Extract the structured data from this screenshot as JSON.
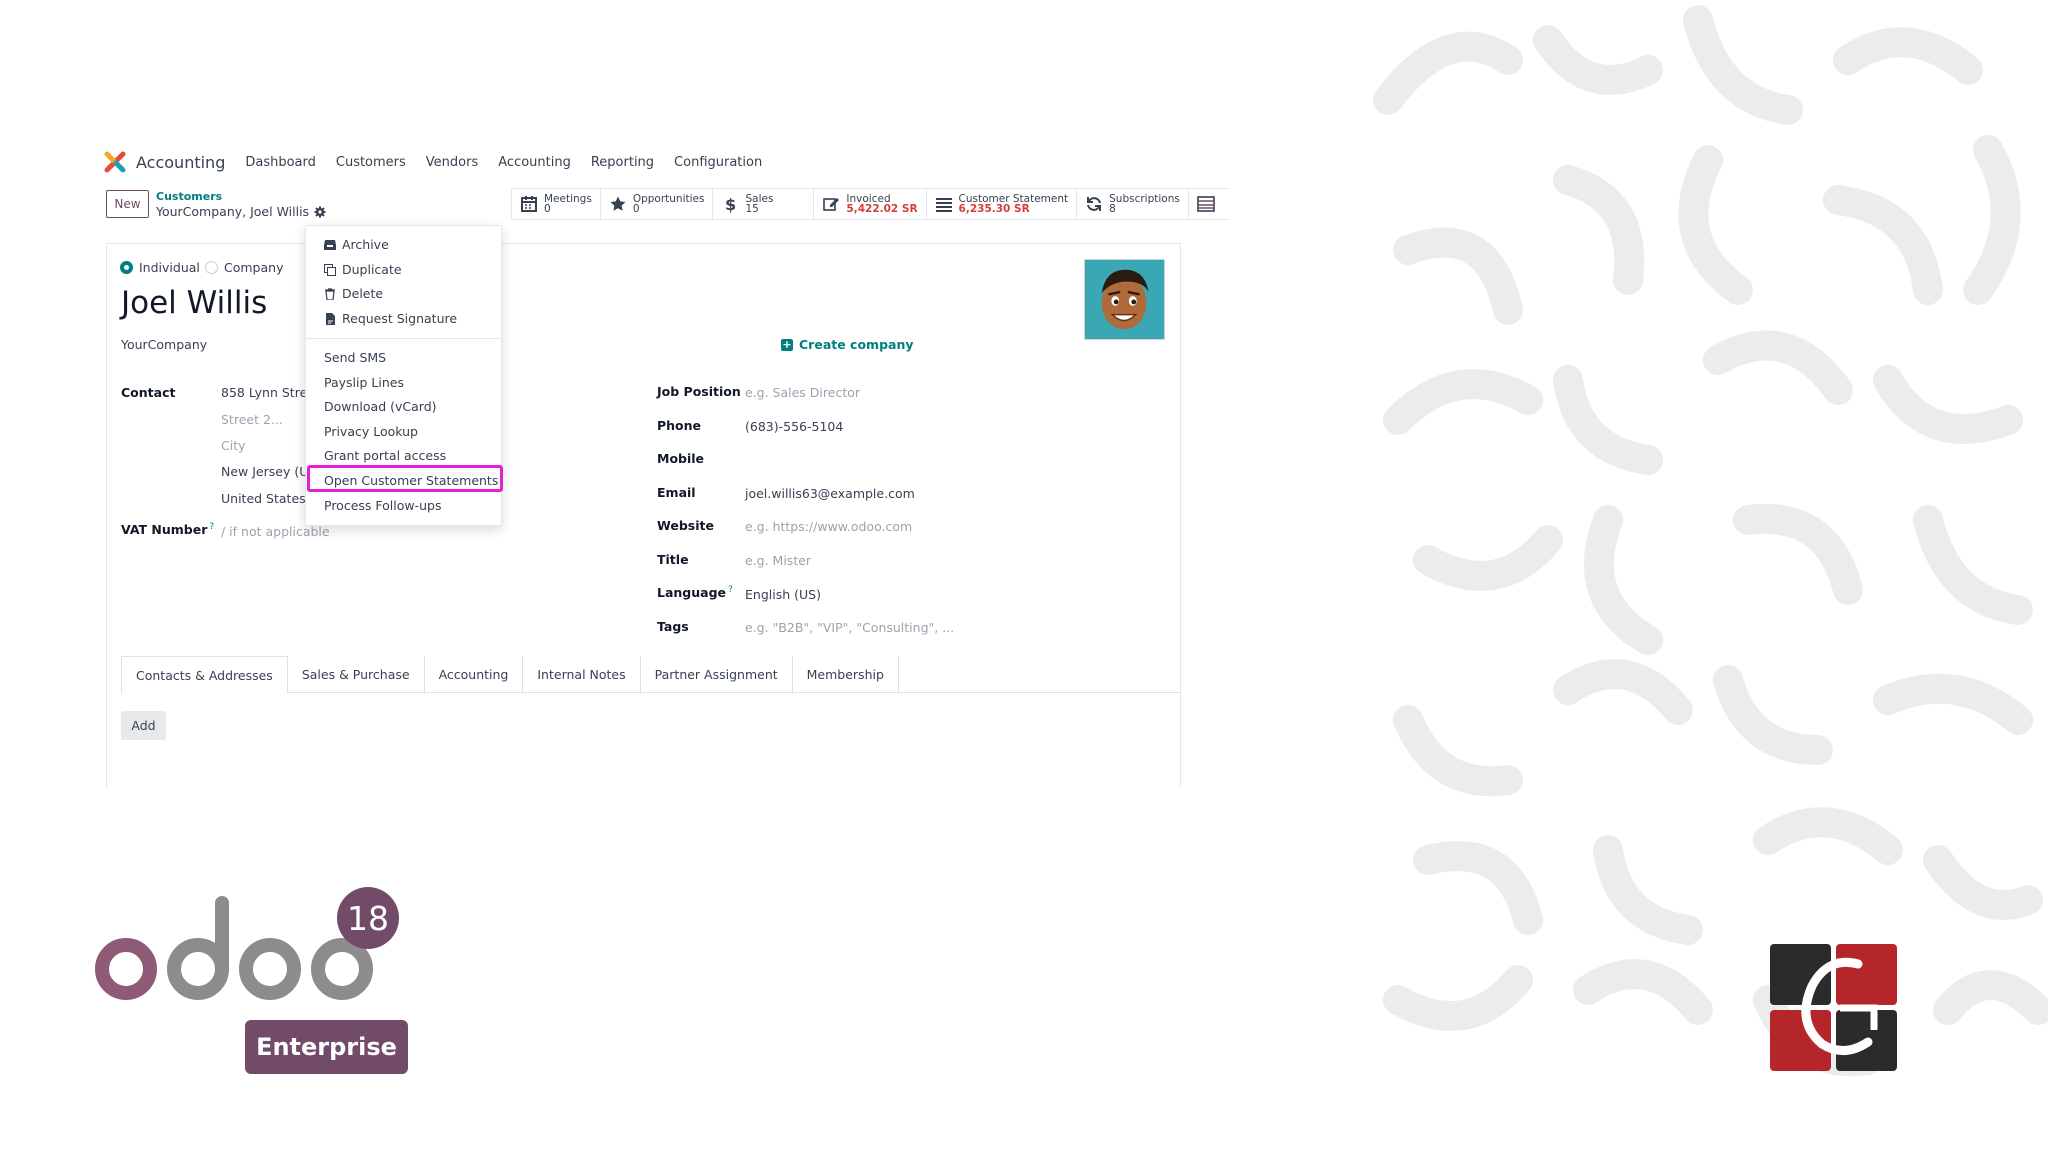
{
  "app": {
    "name": "Accounting"
  },
  "nav": {
    "items": [
      "Dashboard",
      "Customers",
      "Vendors",
      "Accounting",
      "Reporting",
      "Configuration"
    ]
  },
  "control_panel": {
    "new_label": "New",
    "breadcrumb_root": "Customers",
    "breadcrumb_current": "YourCompany, Joel Willis"
  },
  "smart_buttons": [
    {
      "label": "Meetings",
      "value": "0",
      "icon": "calendar-icon"
    },
    {
      "label": "Opportunities",
      "value": "0",
      "icon": "star-icon"
    },
    {
      "label": "Sales",
      "value": "15",
      "icon": "dollar-icon"
    },
    {
      "label": "Invoiced",
      "value": "5,422.02 SR",
      "icon": "pencil-square-icon"
    },
    {
      "label": "Customer Statement",
      "value": "6,235.30 SR",
      "icon": "list-icon"
    },
    {
      "label": "Subscriptions",
      "value": "8",
      "icon": "refresh-icon"
    }
  ],
  "form": {
    "type_individual": "Individual",
    "type_company": "Company",
    "name": "Joel Willis",
    "company": "YourCompany",
    "create_company": "Create company",
    "contact_label": "Contact",
    "street": "858 Lynn Stree",
    "street2_placeholder": "Street 2...",
    "city_placeholder": "City",
    "state": "New Jersey (U",
    "country": "United States",
    "vat_label": "VAT Number",
    "vat_placeholder": "/ if not applicable",
    "job_position_label": "Job Position",
    "job_position_placeholder": "e.g. Sales Director",
    "phone_label": "Phone",
    "phone": "(683)-556-5104",
    "mobile_label": "Mobile",
    "email_label": "Email",
    "email": "joel.willis63@example.com",
    "website_label": "Website",
    "website_placeholder": "e.g. https://www.odoo.com",
    "title_label": "Title",
    "title_placeholder": "e.g. Mister",
    "language_label": "Language",
    "language": "English (US)",
    "tags_label": "Tags",
    "tags_placeholder": "e.g. \"B2B\", \"VIP\", \"Consulting\", ..."
  },
  "tabs": [
    "Contacts & Addresses",
    "Sales & Purchase",
    "Accounting",
    "Internal Notes",
    "Partner Assignment",
    "Membership"
  ],
  "add_label": "Add",
  "action_menu": {
    "group1": [
      "Archive",
      "Duplicate",
      "Delete",
      "Request Signature"
    ],
    "group2": [
      "Send SMS",
      "Payslip Lines",
      "Download (vCard)",
      "Privacy Lookup",
      "Grant portal access",
      "Open Customer Statements",
      "Process Follow-ups"
    ],
    "highlighted": "Open Customer Statements"
  },
  "branding": {
    "odoo_version": "18",
    "edition": "Enterprise",
    "accent_color": "#714B67",
    "teal_color": "#017e84",
    "highlight_color": "#e61fd7"
  }
}
